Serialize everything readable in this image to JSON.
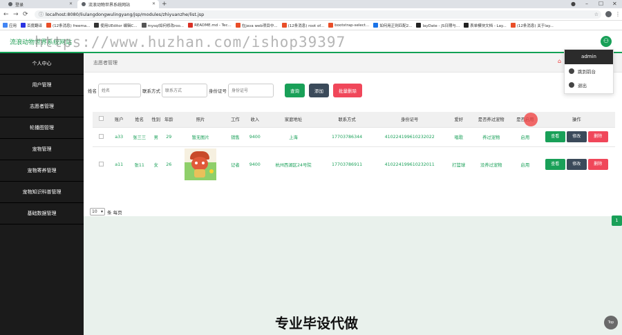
{
  "browser": {
    "tabs": [
      {
        "label": "登录"
      },
      {
        "label": "流浪动物世界系统网站"
      }
    ],
    "new_tab": "+",
    "url": "localhost:8080/liulangdongwulingyang/jsp/modules/zhiyuanzhe/list.jsp",
    "bookmarks": [
      {
        "label": "应用",
        "color": "#4285f4"
      },
      {
        "label": "百度翻译",
        "color": "#2932e1"
      },
      {
        "label": "(12条消息) freema...",
        "color": "#e94e28"
      },
      {
        "label": "使用UEditor 编辑C...",
        "color": "#333333"
      },
      {
        "label": "mysql如何修改roo...",
        "color": "#555555"
      },
      {
        "label": "README.md - Tec...",
        "color": "#d93025"
      },
      {
        "label": "在java web项目中...",
        "color": "#e94e28"
      },
      {
        "label": "(12条消息) root of...",
        "color": "#e94e28"
      },
      {
        "label": "bootstrap-select...",
        "color": "#e94e28"
      },
      {
        "label": "如何用正则匹配2...",
        "color": "#1a73e8"
      },
      {
        "label": "layDate - JS日期与...",
        "color": "#222222"
      },
      {
        "label": "表单模块文档 - Lay...",
        "color": "#222222"
      },
      {
        "label": "(12条消息) 关于lay...",
        "color": "#e94e28"
      }
    ]
  },
  "app": {
    "title": "流浪动物世界系统网站",
    "user_avatar_glyph": "⚇"
  },
  "sidebar": {
    "items": [
      {
        "label": "个人中心"
      },
      {
        "label": "用户管理"
      },
      {
        "label": "志愿者管理"
      },
      {
        "label": "轮播图管理"
      },
      {
        "label": "宠物管理"
      },
      {
        "label": "宠物寄养管理"
      },
      {
        "label": "宠物知识科普管理"
      },
      {
        "label": "基础数据管理"
      }
    ]
  },
  "breadcrumb": {
    "label": "志愿者管理"
  },
  "search": {
    "name_label": "姓名",
    "name_placeholder": "姓名",
    "phone_label": "联系方式",
    "phone_placeholder": "联系方式",
    "id_label": "身份证号",
    "id_placeholder": "身份证号",
    "query_button": "查询",
    "add_button": "添加",
    "batch_delete_button": "批量删除"
  },
  "table": {
    "headers": [
      "账户",
      "姓名",
      "性别",
      "年龄",
      "照片",
      "工作",
      "收入",
      "家庭地址",
      "联系方式",
      "身份证号",
      "爱好",
      "是否养过宠物",
      "是否启用",
      "操作"
    ],
    "rows": [
      {
        "account": "a33",
        "name": "张三三",
        "gender": "男",
        "age": "29",
        "photo": "暂无图片",
        "job": "销售",
        "income": "9400",
        "address": "上海",
        "phone": "17703786344",
        "id_card": "410224199610232022",
        "hobby": "唱歌",
        "had_pet": "养过宠物",
        "enabled": "启用"
      },
      {
        "account": "a11",
        "name": "张11",
        "gender": "女",
        "age": "26",
        "photo": "",
        "job": "记者",
        "income": "9400",
        "address": "杭州西湖区24号院",
        "phone": "17703786911",
        "id_card": "410224199610232011",
        "hobby": "打篮球",
        "had_pet": "没养过宠物",
        "enabled": "启用"
      }
    ],
    "view_button": "查看",
    "edit_button": "修改",
    "delete_button": "删除"
  },
  "pager": {
    "page_size": "10",
    "per_page_text": "条 每页",
    "current_page": "1"
  },
  "user_menu": {
    "username": "admin",
    "items": [
      {
        "label": "跳到前台"
      },
      {
        "label": "退出"
      }
    ]
  },
  "overlay": {
    "watermark": "https://www.huzhan.com/ishop39397",
    "caption": "专业毕设代做",
    "top_button": "Top"
  },
  "colors": {
    "brand_green": "#19a058",
    "danger_red": "#f0475a",
    "dark_button": "#3b4a5a",
    "sidebar_bg": "#1b1b1b"
  }
}
